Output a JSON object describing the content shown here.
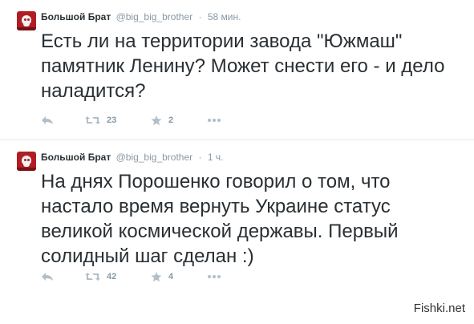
{
  "tweets": [
    {
      "name": "Большой Брат",
      "handle": "@big_big_brother",
      "separator": "·",
      "time": "58 мин.",
      "text": "Есть ли на территории завода \"Южмаш\" памятник Ленину? Может снести его - и дело наладится?",
      "retweets": "23",
      "favorites": "2"
    },
    {
      "name": "Большой Брат",
      "handle": "@big_big_brother",
      "separator": "·",
      "time": "1 ч.",
      "text": "На днях Порошенко говорил о том, что настало время вернуть Украине статус великой космической державы. Первый солидный шаг сделан :)",
      "retweets": "42",
      "favorites": "4"
    }
  ],
  "icons": {
    "reply": "reply-icon",
    "retweet": "retweet-icon",
    "favorite": "star-icon",
    "more": "more-icon"
  },
  "colors": {
    "muted": "#8899a6",
    "text": "#292f33",
    "avatar": "#b01e23"
  },
  "watermark": "Fishki.net"
}
